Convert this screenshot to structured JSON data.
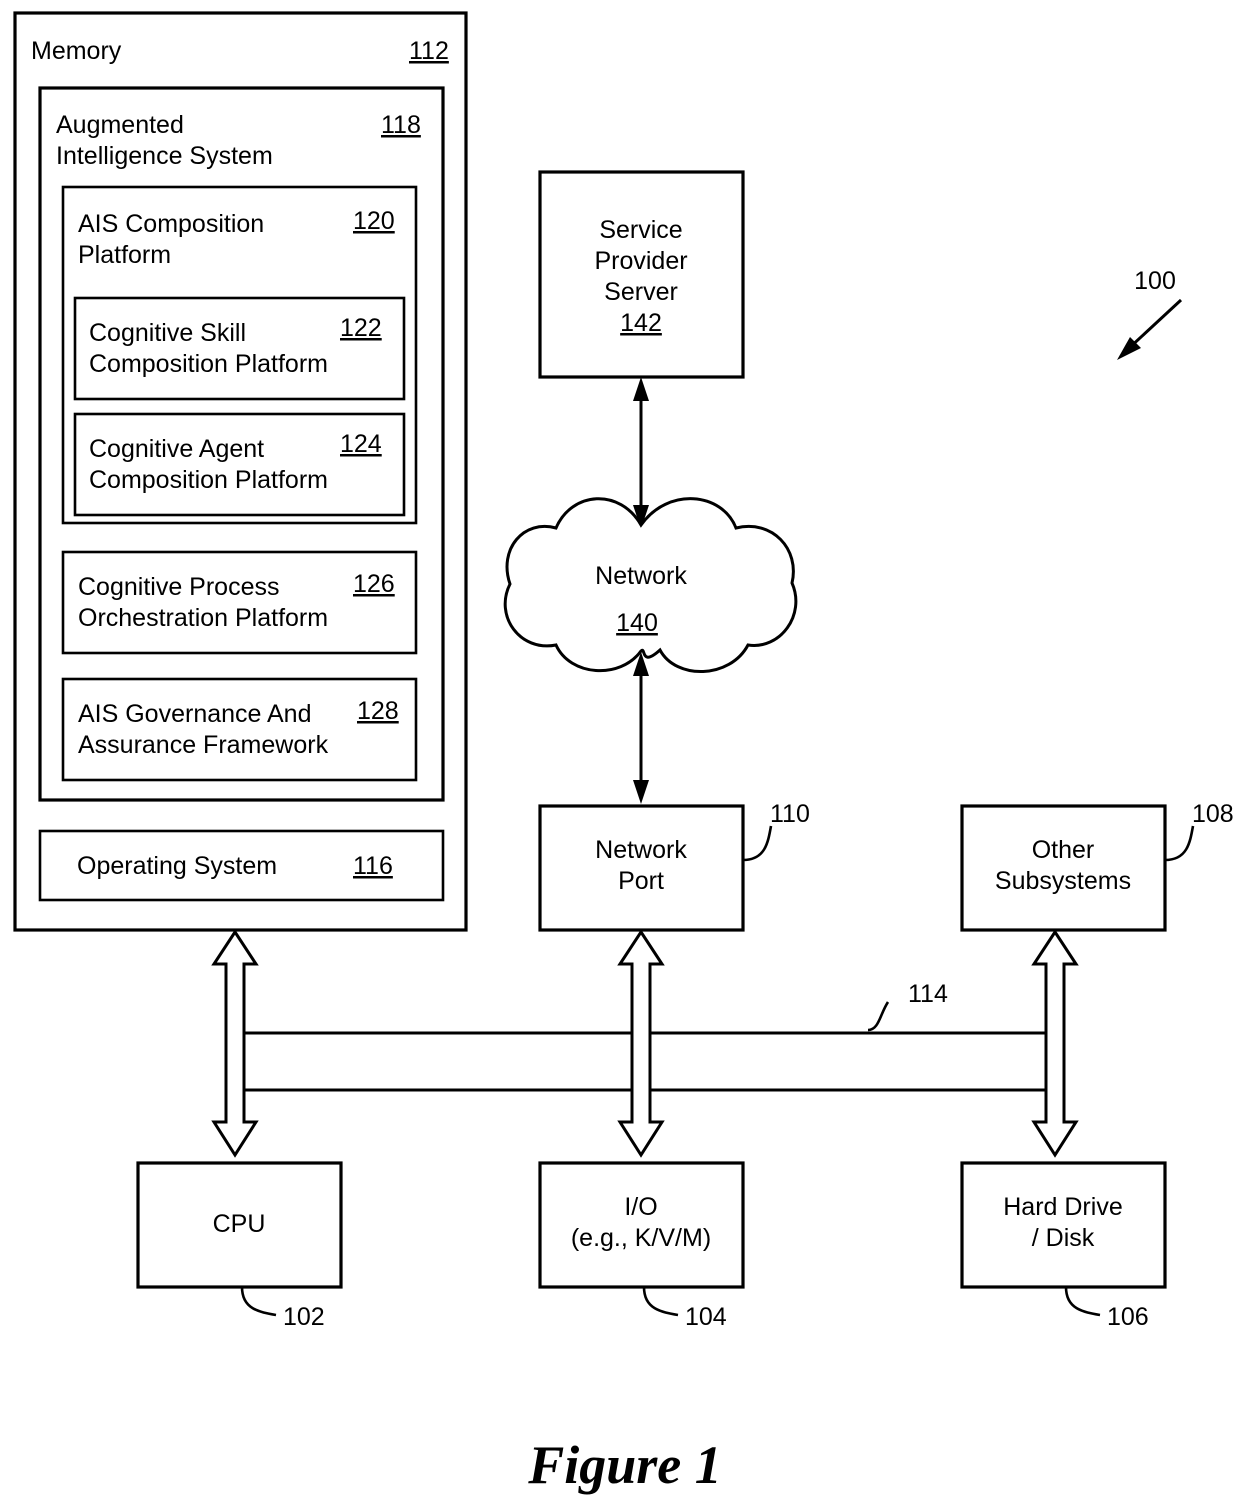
{
  "figure": {
    "caption": "Figure 1",
    "system_ref": "100"
  },
  "memory": {
    "label": "Memory",
    "ref": "112"
  },
  "augmented_intelligence_system": {
    "label_line1": "Augmented",
    "label_line2": "Intelligence System",
    "ref": "118"
  },
  "ais_composition_platform": {
    "label_line1": "AIS Composition",
    "label_line2": "Platform",
    "ref": "120"
  },
  "cognitive_skill_composition_platform": {
    "label_line1": "Cognitive Skill",
    "label_line2": "Composition Platform",
    "ref": "122"
  },
  "cognitive_agent_composition_platform": {
    "label_line1": "Cognitive Agent",
    "label_line2": "Composition Platform",
    "ref": "124"
  },
  "cognitive_process_orchestration_platform": {
    "label_line1": "Cognitive Process",
    "label_line2": "Orchestration Platform",
    "ref": "126"
  },
  "ais_governance_assurance_framework": {
    "label_line1": "AIS Governance And",
    "label_line2": "Assurance Framework",
    "ref": "128"
  },
  "operating_system": {
    "label": "Operating System",
    "ref": "116"
  },
  "service_provider_server": {
    "label_line1": "Service",
    "label_line2": "Provider",
    "label_line3": "Server",
    "ref": "142"
  },
  "network": {
    "label": "Network",
    "ref": "140"
  },
  "network_port": {
    "label_line1": "Network",
    "label_line2": "Port",
    "ref": "110"
  },
  "other_subsystems": {
    "label_line1": "Other",
    "label_line2": "Subsystems",
    "ref": "108"
  },
  "bus": {
    "ref": "114"
  },
  "cpu": {
    "label": "CPU",
    "ref": "102"
  },
  "io": {
    "label_line1": "I/O",
    "label_line2": "(e.g., K/V/M)",
    "ref": "104"
  },
  "hard_drive": {
    "label_line1": "Hard Drive",
    "label_line2": "/ Disk",
    "ref": "106"
  },
  "colors": {
    "stroke": "#000000",
    "background": "#ffffff"
  }
}
